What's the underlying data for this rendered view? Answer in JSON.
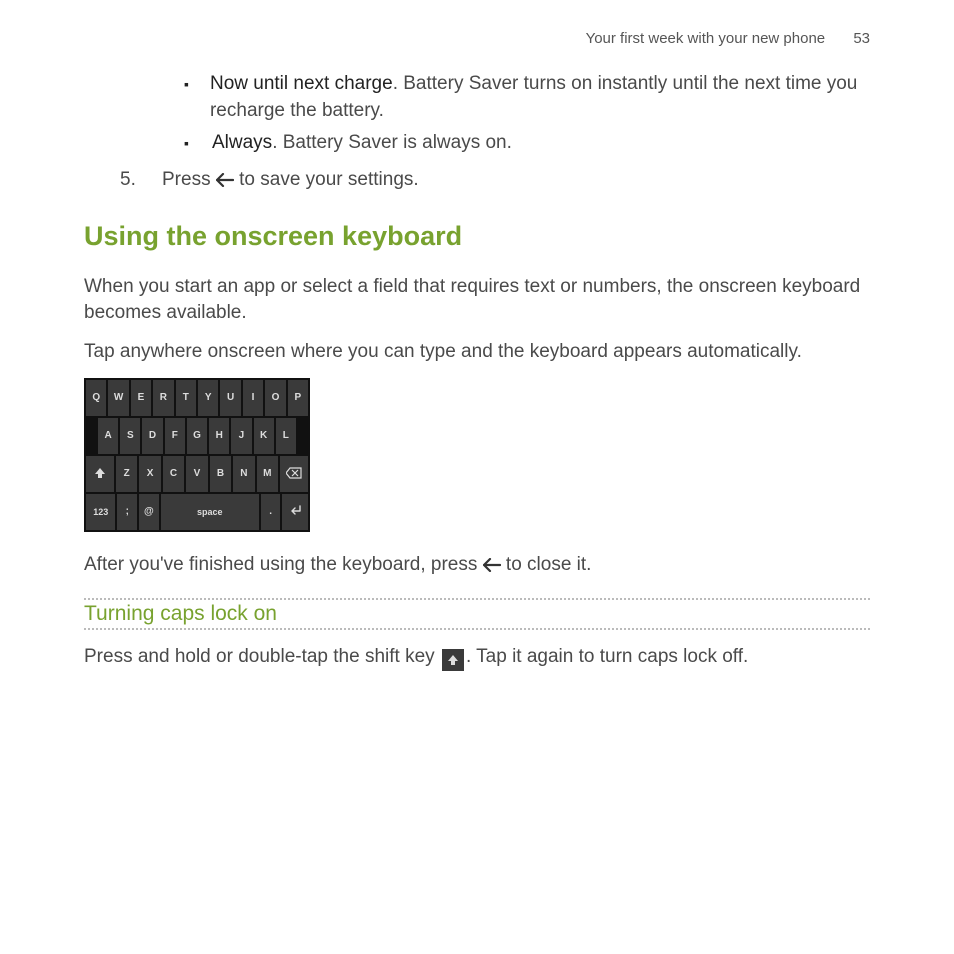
{
  "header": {
    "title": "Your first week with your new phone",
    "page_number": "53"
  },
  "bullets": [
    {
      "lead": "Now until next charge",
      "rest": ". Battery Saver turns on instantly until the next time you recharge the battery."
    },
    {
      "lead": "Always",
      "rest": ". Battery Saver is always on."
    }
  ],
  "step5": {
    "num": "5.",
    "before": "Press ",
    "after": " to save your settings."
  },
  "section": {
    "heading": "Using the onscreen keyboard"
  },
  "para1": "When you start an app or select a field that requires text or numbers, the onscreen keyboard becomes available.",
  "para2": "Tap anywhere onscreen where you can type and the keyboard appears automatically.",
  "keyboard": {
    "row1": [
      "Q",
      "W",
      "E",
      "R",
      "T",
      "Y",
      "U",
      "I",
      "O",
      "P"
    ],
    "row2": [
      "A",
      "S",
      "D",
      "F",
      "G",
      "H",
      "J",
      "K",
      "L"
    ],
    "row3_letters": [
      "Z",
      "X",
      "C",
      "V",
      "B",
      "N",
      "M"
    ],
    "k123": "123",
    "semi": ";",
    "at": "@",
    "space": "space",
    "dot": "."
  },
  "para3": {
    "before": "After you've finished using the keyboard, press ",
    "after": " to close it."
  },
  "sub": {
    "heading": "Turning caps lock on"
  },
  "caps": {
    "before": "Press and hold or double-tap the shift key ",
    "after": ". Tap it again to turn caps lock off."
  }
}
